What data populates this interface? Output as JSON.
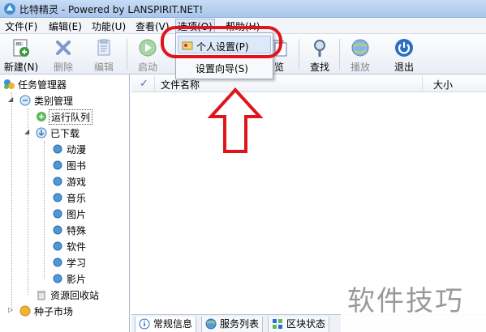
{
  "window": {
    "title": "比特精灵 - Powered by LANSPIRIT.NET!"
  },
  "menubar": {
    "items": [
      {
        "label": "文件(F)"
      },
      {
        "label": "编辑(E)"
      },
      {
        "label": "功能(U)"
      },
      {
        "label": "查看(V)"
      },
      {
        "label": "选项(O)"
      },
      {
        "label": "帮助(H)"
      }
    ]
  },
  "options_menu": {
    "items": [
      {
        "label": "个人设置(P)",
        "icon": "settings-card-icon",
        "highlighted": true
      },
      {
        "label": "设置向导(S)"
      }
    ]
  },
  "toolbar": {
    "buttons": [
      {
        "label": "新建(N)",
        "icon": "new-icon",
        "enabled": true
      },
      {
        "label": "删除",
        "icon": "delete-icon",
        "enabled": false
      },
      {
        "label": "编辑",
        "icon": "edit-icon",
        "enabled": false
      },
      {
        "label": "启动",
        "icon": "play-icon",
        "enabled": false
      },
      {
        "label": "览",
        "icon": "browse-icon",
        "enabled": true
      },
      {
        "label": "查找",
        "icon": "search-icon",
        "enabled": true
      },
      {
        "label": "播放",
        "icon": "globe-icon",
        "enabled": false
      },
      {
        "label": "退出",
        "icon": "power-icon",
        "enabled": true
      }
    ]
  },
  "tree": {
    "root": "任务管理器",
    "category": "类别管理",
    "running": "运行队列",
    "downloaded": "已下载",
    "subcategories": [
      "动漫",
      "图书",
      "游戏",
      "音乐",
      "图片",
      "特殊",
      "软件",
      "学习",
      "影片"
    ],
    "recycle": "资源回收站",
    "seed_market": "种子市场"
  },
  "filelist": {
    "columns": {
      "name": "文件名称",
      "size": "大小"
    }
  },
  "bottom_tabs": [
    {
      "label": "常规信息",
      "icon": "info-icon"
    },
    {
      "label": "服务列表",
      "icon": "server-globe-icon"
    },
    {
      "label": "区块状态",
      "icon": "blocks-icon"
    }
  ],
  "watermark": "软件技巧",
  "colors": {
    "annotation_red": "#e0151b",
    "menu_highlight": "#dce9f9",
    "title_bar": "#b8d2f0"
  }
}
